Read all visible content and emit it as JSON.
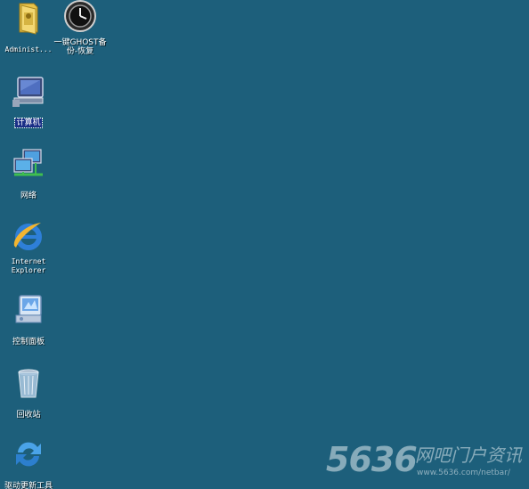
{
  "desktop": {
    "background_color": "#1d5f7b",
    "icons": [
      {
        "label": "Administ...",
        "icon": "user-folder-icon"
      },
      {
        "label": "一键GHOST备\n份-恢复",
        "icon": "ghost-clock-icon"
      },
      {
        "label": "计算机",
        "icon": "computer-icon",
        "selected": true
      },
      {
        "label": "网络",
        "icon": "network-icon"
      },
      {
        "label": "Internet\nExplorer",
        "icon": "internet-explorer-icon"
      },
      {
        "label": "控制面板",
        "icon": "control-panel-icon"
      },
      {
        "label": "回收站",
        "icon": "recycle-bin-icon"
      },
      {
        "label": "驱动更新工具",
        "icon": "driver-update-icon"
      }
    ]
  },
  "watermark": {
    "number": "5636",
    "chinese": "网吧门户资讯",
    "url": "www.5636.com/netbar/"
  }
}
